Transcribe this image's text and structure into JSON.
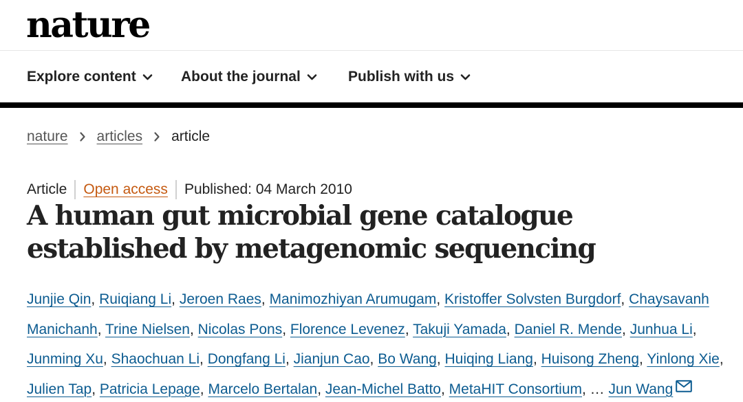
{
  "site": {
    "logo": "nature"
  },
  "nav": {
    "items": [
      {
        "label": "Explore content",
        "icon": "chevron-down-icon"
      },
      {
        "label": "About the journal",
        "icon": "chevron-down-icon"
      },
      {
        "label": "Publish with us",
        "icon": "chevron-down-icon"
      }
    ]
  },
  "breadcrumb": {
    "items": [
      "nature",
      "articles"
    ],
    "current": "article",
    "separator_icon": "chevron-right-icon"
  },
  "article": {
    "type": "Article",
    "access": "Open access",
    "published": "Published: 04 March 2010",
    "title": "A human gut microbial gene catalogue established by metagenomic sequencing",
    "ellipsis": "…",
    "corresponding_icon": "mail-icon",
    "authors": [
      "Junjie Qin",
      "Ruiqiang Li",
      "Jeroen Raes",
      "Manimozhiyan Arumugam",
      "Kristoffer Solvsten Burgdorf",
      "Chaysavanh Manichanh",
      "Trine Nielsen",
      "Nicolas Pons",
      "Florence Levenez",
      "Takuji Yamada",
      "Daniel R. Mende",
      "Junhua Li",
      "Junming Xu",
      "Shaochuan Li",
      "Dongfang Li",
      "Jianjun Cao",
      "Bo Wang",
      "Huiqing Liang",
      "Huisong Zheng",
      "Yinlong Xie",
      "Julien Tap",
      "Patricia Lepage",
      "Marcelo Bertalan",
      "Jean-Michel Batto",
      "MetaHIT Consortium"
    ],
    "last_author": "Jun Wang"
  },
  "colors": {
    "link": "#0d5c91",
    "open_access": "#c55a11",
    "text": "#222222",
    "rule": "#000000"
  }
}
